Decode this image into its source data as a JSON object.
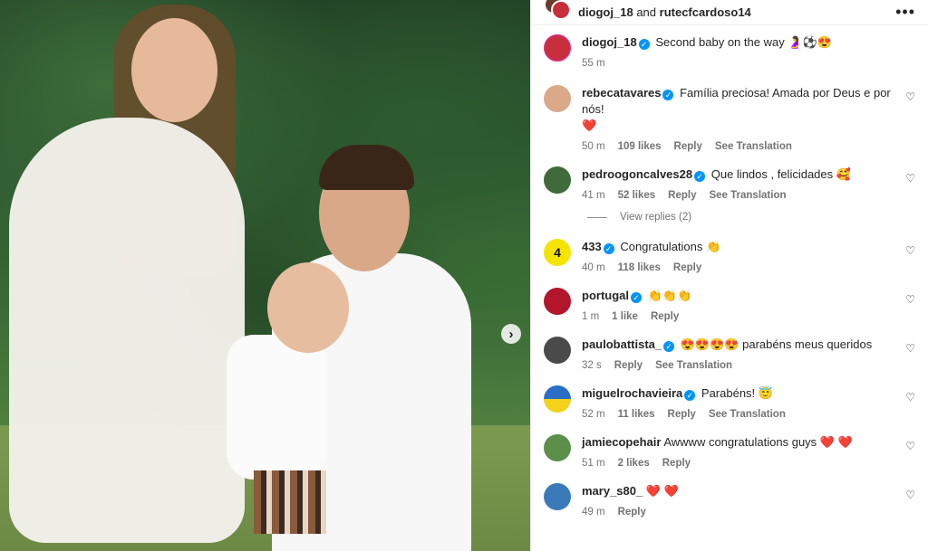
{
  "header": {
    "user1": "diogoj_18",
    "and": "and",
    "user2": "rutecfcardoso14",
    "more": "•••"
  },
  "photo": {
    "next_icon": "chevron-right"
  },
  "caption": {
    "user": "diogoj_18",
    "text": "Second baby on the way 🤰⚽😍",
    "time": "55 m"
  },
  "comments": [
    {
      "user": "rebecatavares",
      "text": "Família preciosa! Amada por Deus e por nós!",
      "text2": "❤️",
      "time": "50 m",
      "likes": "109 likes",
      "reply": "Reply",
      "translate": "See Translation",
      "avatar_color": "#d9a98a"
    },
    {
      "user": "pedroogoncalves28",
      "text": "Que lindos , felicidades 🥰",
      "time": "41 m",
      "likes": "52 likes",
      "reply": "Reply",
      "translate": "See Translation",
      "avatar_color": "#3f6a3a"
    },
    {
      "user": "433",
      "text": "Congratulations 👏",
      "time": "40 m",
      "likes": "118 likes",
      "reply": "Reply",
      "translate": "",
      "avatar_color": "#f5e400"
    },
    {
      "user": "portugal",
      "text": "👏👏👏",
      "time": "1 m",
      "likes": "1 like",
      "reply": "Reply",
      "translate": "",
      "avatar_color": "#b3162b"
    },
    {
      "user": "paulobattista_",
      "text": "😍😍😍😍 parabéns meus queridos",
      "time": "32 s",
      "likes": "",
      "reply": "Reply",
      "translate": "See Translation",
      "avatar_color": "#4a4a4a"
    },
    {
      "user": "miguelrochavieira",
      "text": "Parabéns! 😇",
      "time": "52 m",
      "likes": "11 likes",
      "reply": "Reply",
      "translate": "See Translation",
      "avatar_color": "#2a6fc6"
    },
    {
      "user": "jamiecopehair",
      "text": "Awwww congratulations guys ❤️ ❤️",
      "time": "51 m",
      "likes": "2 likes",
      "reply": "Reply",
      "translate": "",
      "avatar_color": "#5b8f4a"
    },
    {
      "user": "mary_s80_",
      "text": "❤️ ❤️",
      "time": "49 m",
      "likes": "",
      "reply": "Reply",
      "translate": "",
      "avatar_color": "#3a7ab8"
    }
  ],
  "view_replies": "View replies (2)"
}
